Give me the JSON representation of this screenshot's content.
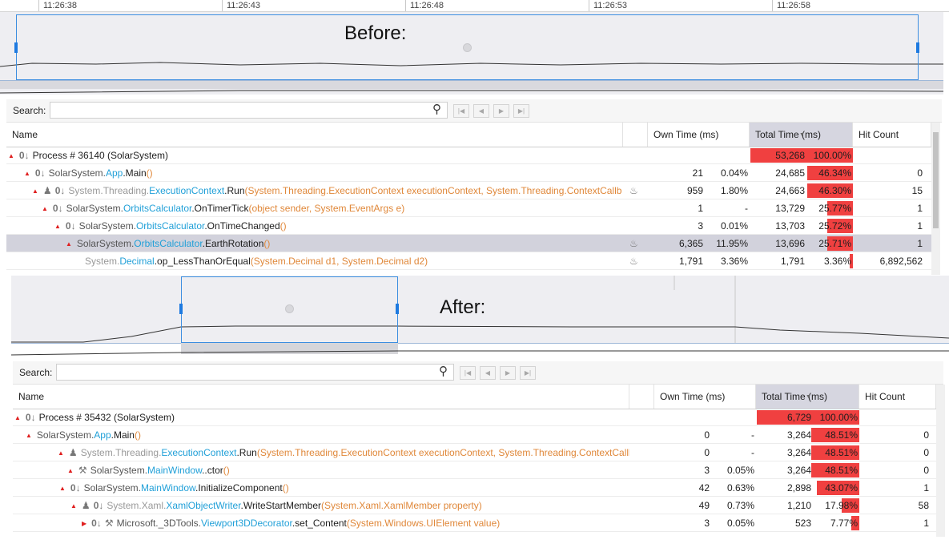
{
  "colors": {
    "accent": "#3c8ee0",
    "bar": "#f04040",
    "class_link": "#21a0d8",
    "param": "#e0883a",
    "selected_row": "#d2d2dc"
  },
  "timeline": {
    "ticks": [
      "11:26:38",
      "11:26:43",
      "11:26:48",
      "11:26:53",
      "11:26:58"
    ]
  },
  "labels": {
    "before": "Before:",
    "after": "After:"
  },
  "toolbar": {
    "search_label": "Search:",
    "search_placeholder": "",
    "nav_icons": [
      "first-icon",
      "prev-icon",
      "next-icon",
      "last-icon"
    ]
  },
  "columns": {
    "name": "Name",
    "own_time": "Own Time (ms)",
    "total_time": "Total Time (ms)",
    "hit_count": "Hit Count"
  },
  "before": {
    "rows": [
      {
        "tri": "▲",
        "icons": "0↓",
        "person": false,
        "wrench": false,
        "ns": "",
        "cls": "",
        "mth": "Process  # 36140 (SolarSystem)",
        "par": "",
        "fire": false,
        "own": "",
        "own_pct": "",
        "total": "53,268",
        "total_pct": "100.00%",
        "pct": 100,
        "hits": "",
        "sel": false
      },
      {
        "tri": "▲",
        "icons": "0↓",
        "person": false,
        "wrench": false,
        "ns": "SolarSystem.",
        "cls": "App",
        "mth": ".Main",
        "par": "()",
        "fire": false,
        "own": "21",
        "own_pct": "0.04%",
        "total": "24,685",
        "total_pct": "46.34%",
        "pct": 46.34,
        "hits": "0",
        "sel": false
      },
      {
        "tri": "▲",
        "icons": "0↓",
        "person": true,
        "wrench": false,
        "ns": "System.Threading.",
        "cls": "ExecutionContext",
        "mth": ".Run",
        "par": "(System.Threading.ExecutionContext executionContext, System.Threading.ContextCallb",
        "fire": true,
        "own": "959",
        "own_pct": "1.80%",
        "total": "24,663",
        "total_pct": "46.30%",
        "pct": 46.3,
        "hits": "15",
        "sel": false
      },
      {
        "tri": "▲",
        "icons": "0↓",
        "person": false,
        "wrench": false,
        "ns": "SolarSystem.",
        "cls": "OrbitsCalculator",
        "mth": ".OnTimerTick",
        "par": "(object sender, System.EventArgs e)",
        "fire": false,
        "own": "1",
        "own_pct": "-",
        "total": "13,729",
        "total_pct": "25.77%",
        "pct": 25.77,
        "hits": "1",
        "sel": false
      },
      {
        "tri": "▲",
        "icons": "0↓",
        "person": false,
        "wrench": false,
        "ns": "SolarSystem.",
        "cls": "OrbitsCalculator",
        "mth": ".OnTimeChanged",
        "par": "()",
        "fire": false,
        "own": "3",
        "own_pct": "0.01%",
        "total": "13,703",
        "total_pct": "25.72%",
        "pct": 25.72,
        "hits": "1",
        "sel": false
      },
      {
        "tri": "▲",
        "icons": "",
        "person": false,
        "wrench": false,
        "ns": "SolarSystem.",
        "cls": "OrbitsCalculator",
        "mth": ".EarthRotation",
        "par": "()",
        "fire": true,
        "own": "6,365",
        "own_pct": "11.95%",
        "total": "13,696",
        "total_pct": "25.71%",
        "pct": 25.71,
        "hits": "1",
        "sel": true
      },
      {
        "tri": "",
        "icons": "",
        "person": false,
        "wrench": false,
        "ns": "System.",
        "cls": "Decimal",
        "mth": ".op_LessThanOrEqual",
        "par": "(System.Decimal d1, System.Decimal d2)",
        "fire": true,
        "own": "1,791",
        "own_pct": "3.36%",
        "total": "1,791",
        "total_pct": "3.36%",
        "pct": 3.36,
        "hits": "6,892,562",
        "sel": false
      }
    ]
  },
  "after": {
    "rows": [
      {
        "tri": "▲",
        "icons": "0↓",
        "person": false,
        "wrench": false,
        "ns": "",
        "cls": "",
        "mth": "Process  # 35432 (SolarSystem)",
        "par": "",
        "fire": false,
        "own": "",
        "own_pct": "",
        "total": "6,729",
        "total_pct": "100.00%",
        "pct": 100,
        "hits": "",
        "sel": false
      },
      {
        "tri": "▲",
        "icons": "",
        "person": false,
        "wrench": false,
        "ns": "SolarSystem.",
        "cls": "App",
        "mth": ".Main",
        "par": "()",
        "fire": false,
        "own": "0",
        "own_pct": "-",
        "total": "3,264",
        "total_pct": "48.51%",
        "pct": 48.51,
        "hits": "0",
        "sel": false
      },
      {
        "tri": "▲",
        "icons": "",
        "person": true,
        "wrench": false,
        "ns": "System.Threading.",
        "cls": "ExecutionContext",
        "mth": ".Run",
        "par": "(System.Threading.ExecutionContext executionContext, System.Threading.ContextCallback",
        "fire": false,
        "own": "0",
        "own_pct": "-",
        "total": "3,264",
        "total_pct": "48.51%",
        "pct": 48.51,
        "hits": "0",
        "sel": false
      },
      {
        "tri": "▲",
        "icons": "",
        "person": false,
        "wrench": true,
        "ns": "SolarSystem.",
        "cls": "MainWindow",
        "mth": "..ctor",
        "par": "()",
        "fire": false,
        "own": "3",
        "own_pct": "0.05%",
        "total": "3,264",
        "total_pct": "48.51%",
        "pct": 48.51,
        "hits": "0",
        "sel": false
      },
      {
        "tri": "▲",
        "icons": "0↓",
        "person": false,
        "wrench": false,
        "ns": "SolarSystem.",
        "cls": "MainWindow",
        "mth": ".InitializeComponent",
        "par": "()",
        "fire": false,
        "own": "42",
        "own_pct": "0.63%",
        "total": "2,898",
        "total_pct": "43.07%",
        "pct": 43.07,
        "hits": "1",
        "sel": false
      },
      {
        "tri": "▲",
        "icons": "0↓",
        "person": true,
        "wrench": false,
        "ns": "System.Xaml.",
        "cls": "XamlObjectWriter",
        "mth": ".WriteStartMember",
        "par": "(System.Xaml.XamlMember property)",
        "fire": false,
        "own": "49",
        "own_pct": "0.73%",
        "total": "1,210",
        "total_pct": "17.98%",
        "pct": 17.98,
        "hits": "58",
        "sel": false
      },
      {
        "tri": "▶",
        "icons": "0↓",
        "person": false,
        "wrench": true,
        "ns": "Microsoft._3DTools.",
        "cls": "Viewport3DDecorator",
        "mth": ".set_Content",
        "par": "(System.Windows.UIElement value)",
        "fire": false,
        "own": "3",
        "own_pct": "0.05%",
        "total": "523",
        "total_pct": "7.77%",
        "pct": 7.77,
        "hits": "1",
        "sel": false
      }
    ]
  }
}
